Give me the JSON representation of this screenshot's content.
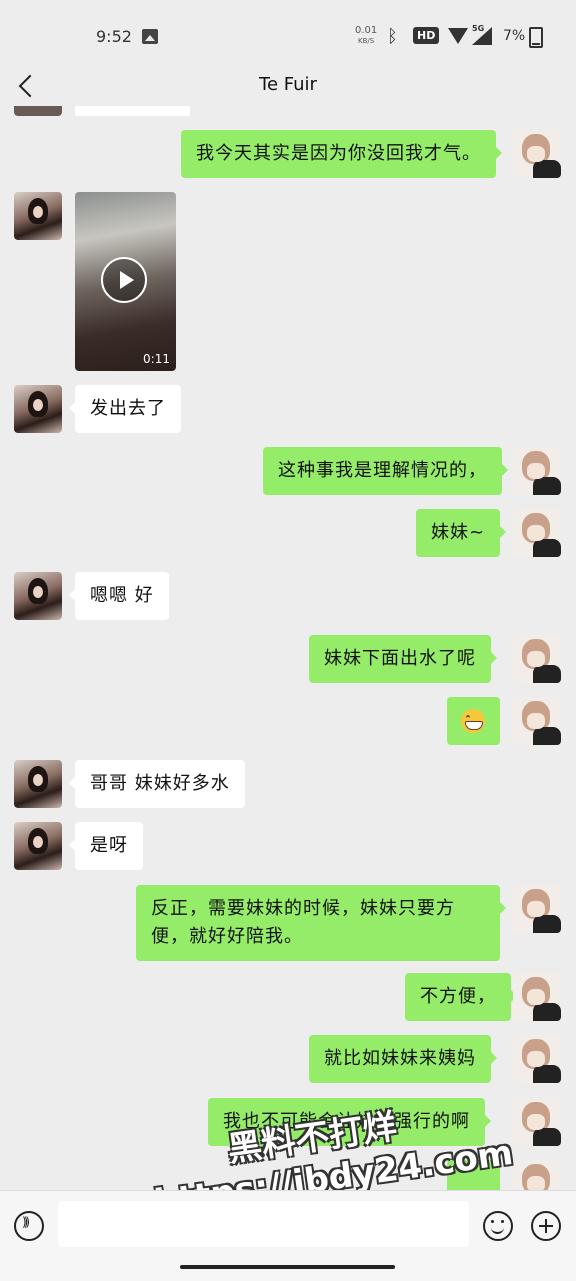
{
  "status_bar": {
    "time": "9:52",
    "net_speed": "0.01",
    "net_unit": "KB/S",
    "hd": "HD",
    "network": "5G",
    "battery": "7%"
  },
  "header": {
    "title": "Te Fuir"
  },
  "messages": [
    {
      "side": "right",
      "type": "text",
      "text": "我今天其实是因为你没回我才气。"
    },
    {
      "side": "left",
      "type": "video",
      "duration": "0:11"
    },
    {
      "side": "left",
      "type": "text",
      "text": "发出去了"
    },
    {
      "side": "right",
      "type": "text",
      "text": "这种事我是理解情况的，"
    },
    {
      "side": "right",
      "type": "text",
      "text": "妹妹~"
    },
    {
      "side": "left",
      "type": "text",
      "text": "嗯嗯 好"
    },
    {
      "side": "right",
      "type": "text",
      "text": "妹妹下面出水了呢"
    },
    {
      "side": "right",
      "type": "emoji",
      "icon": "grinning-face-icon"
    },
    {
      "side": "left",
      "type": "text",
      "text": "哥哥 妹妹好多水"
    },
    {
      "side": "left",
      "type": "text",
      "text": "是呀"
    },
    {
      "side": "right",
      "type": "text",
      "text": "反正，需要妹妹的时候，妹妹只要方便，就好好陪我。"
    },
    {
      "side": "right",
      "type": "text",
      "text": "不方便，"
    },
    {
      "side": "right",
      "type": "text",
      "text": "就比如妹妹来姨妈"
    },
    {
      "side": "right",
      "type": "text",
      "text": "我也不可能会让妹妹强行的啊"
    }
  ],
  "watermark": {
    "line1": "黑料不打烊",
    "line2": "https://ibdy24.com"
  },
  "colors": {
    "chat_bg": "#ededed",
    "sent_bubble": "#95ec69",
    "received_bubble": "#ffffff"
  }
}
